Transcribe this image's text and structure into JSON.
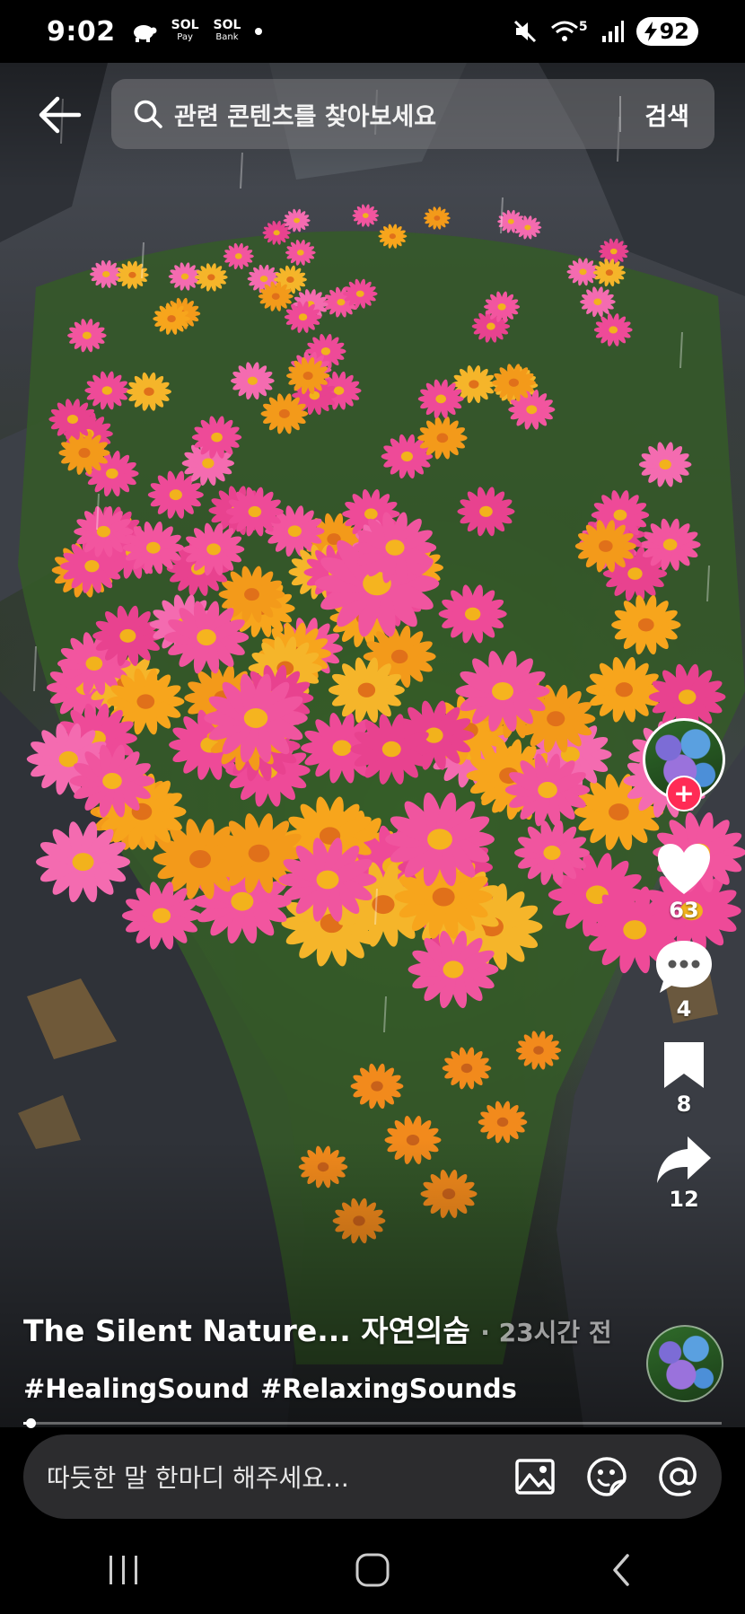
{
  "status_bar": {
    "time": "9:02",
    "app1_top": "SOL",
    "app1_bottom": "Pay",
    "app2_top": "SOL",
    "app2_bottom": "Bank",
    "network": "5",
    "battery": "92"
  },
  "search": {
    "placeholder": "관련 콘텐츠를 찾아보세요",
    "button_label": "검색"
  },
  "actions": {
    "follow_symbol": "+",
    "likes": "63",
    "comments": "4",
    "saves": "8",
    "shares": "12"
  },
  "caption": {
    "author": "The Silent Nature... 자연의숨",
    "time_ago": "· 23시간 전",
    "hashtags": [
      "#HealingSound",
      "#RelaxingSounds"
    ]
  },
  "playback": {
    "progress_fraction": 0.01
  },
  "comment_bar": {
    "placeholder": "따듯한 말 한마디 해주세요..."
  },
  "icons": {
    "back": "arrow-left-icon",
    "search": "search-icon",
    "like": "heart-icon",
    "comment": "speech-bubble-icon",
    "save": "bookmark-icon",
    "share": "share-arrow-icon",
    "image": "image-icon",
    "sticker": "sticker-icon",
    "mention": "at-sign-icon"
  },
  "colors": {
    "follow_badge": "#ff2b55",
    "comment_bar_bg": "#2c2c2e"
  }
}
